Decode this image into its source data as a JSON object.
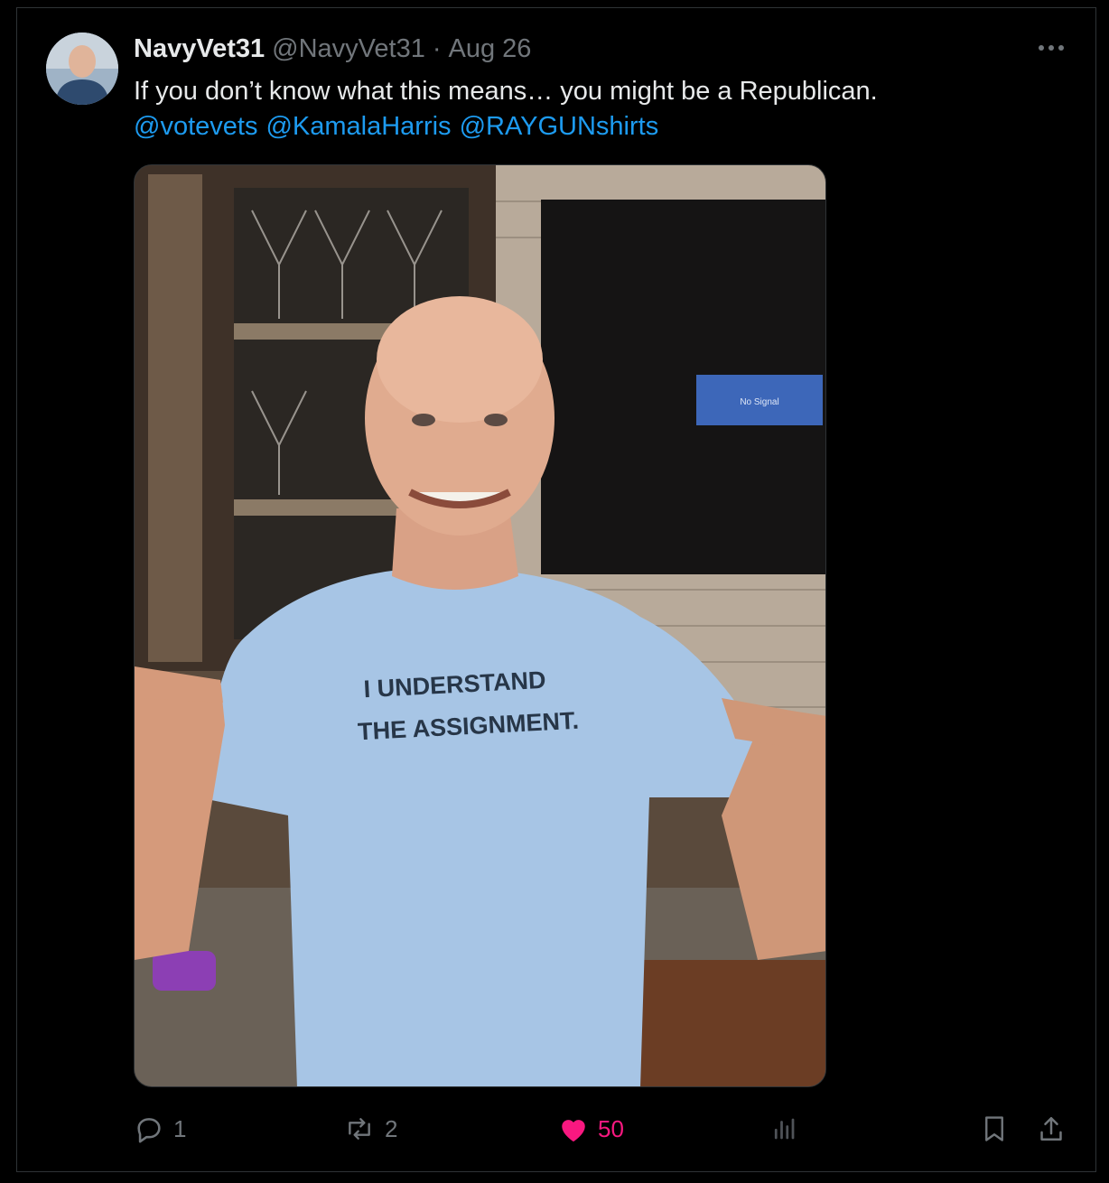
{
  "tweet": {
    "display_name": "NavyVet31",
    "handle": "@NavyVet31",
    "separator": "·",
    "date": "Aug 26",
    "text": "If you don’t know what this means… you might be a Republican.",
    "mentions": [
      "@votevets",
      "@KamalaHarris",
      "@RAYGUNshirts"
    ]
  },
  "media": {
    "shirt_line1": "I UNDERSTAND",
    "shirt_line2": "THE ASSIGNMENT.",
    "tv_notice": "No Signal"
  },
  "actions": {
    "replies": "1",
    "reposts": "2",
    "likes": "50",
    "liked": true
  },
  "colors": {
    "background": "#000000",
    "text": "#e7e9ea",
    "muted": "#71767b",
    "link": "#1d9bf0",
    "like": "#f91880",
    "border": "#2f3336"
  },
  "icons": [
    "reply-icon",
    "repost-icon",
    "like-icon",
    "views-icon",
    "bookmark-icon",
    "share-icon",
    "more-icon"
  ]
}
